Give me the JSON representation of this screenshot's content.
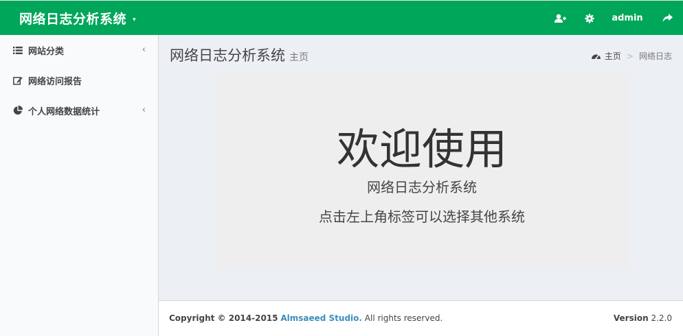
{
  "header": {
    "brand": "网络日志分析系统",
    "brand_caret": "▾",
    "nav": {
      "user_add_icon": "user-plus-icon",
      "settings_icon": "gear-icon",
      "user": "admin",
      "share_icon": "share-icon"
    },
    "accent_color": "#00a65a"
  },
  "sidebar": {
    "items": [
      {
        "label": "网站分类",
        "icon": "list-icon",
        "expandable": true
      },
      {
        "label": "网络访问报告",
        "icon": "edit-icon",
        "expandable": false
      },
      {
        "label": "个人网络数据统计",
        "icon": "pie-chart-icon",
        "expandable": true
      }
    ],
    "chevron": "‹"
  },
  "content_header": {
    "title": "网络日志分析系统",
    "subtitle": "主页"
  },
  "breadcrumb": {
    "home": "主页",
    "separator": ">",
    "current": "网络日志"
  },
  "welcome": {
    "title": "欢迎使用",
    "subtitle": "网络日志分析系统",
    "hint": "点击左上角标签可以选择其他系统"
  },
  "footer": {
    "copyright_prefix": "Copyright © 2014-2015",
    "studio": "Almsaeed Studio.",
    "rights": "All rights reserved.",
    "version_label": "Version",
    "version_number": "2.2.0"
  }
}
